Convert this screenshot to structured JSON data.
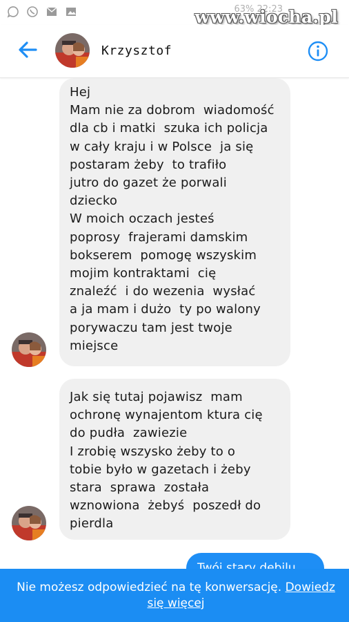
{
  "status_bar": {
    "icons": [
      "signal-icon",
      "whatsapp-icon",
      "mail-icon",
      "gallery-icon"
    ],
    "battery_text": "63% 22:23"
  },
  "watermark": "www.wiocha.pl",
  "header": {
    "contact_name": "Krzysztof",
    "back_icon": "arrow-left-icon",
    "info_icon": "info-icon",
    "accent_color": "#1e8ef5"
  },
  "messages": [
    {
      "direction": "incoming",
      "text": "Hej\nMam nie za dobrom  wiadomość\ndla cb i matki  szuka ich policja\nw cały kraju i w Polsce  ja się\npostaram żeby  to trafiło\njutro do gazet że porwali\ndziecko\nW moich oczach jesteś\npoprosy  frajerami damskim\nbokserem  pomogę wszyskim\nmojim kontraktami  cię\nznaleźć  i do wezenia  wysłać\na ja mam i dużo  ty po walony\nporywaczu tam jest twoje\nmiejsce"
    },
    {
      "direction": "incoming",
      "text": "Jak się tutaj pojawisz  mam\nochronę wynajentom ktura cię\ndo pudła  zawiezie\nI zrobię wszysko żeby to o\ntobie było w gazetach i żeby\nstara  sprawa  została\nwznowiona  żebyś  poszedł do\npierdla"
    },
    {
      "direction": "outgoing",
      "text": "Twój stary debilu"
    }
  ],
  "footer": {
    "notice": "Nie możesz odpowiedzieć na tę konwersację.",
    "link_label": "Dowiedz się więcej",
    "bar_color": "#1b8df3"
  }
}
